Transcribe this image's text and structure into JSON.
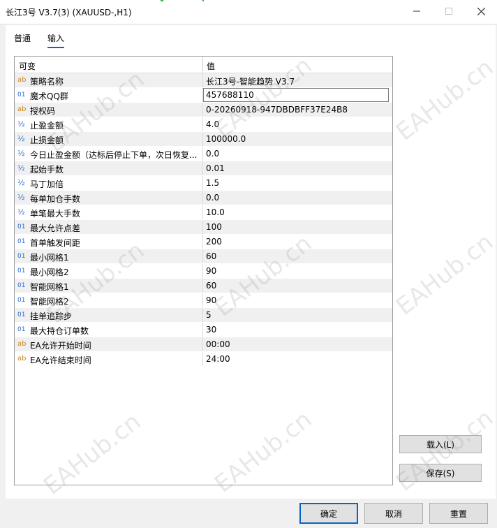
{
  "window": {
    "title": "长江3号 V3.7(3) (XAUUSD-,H1)"
  },
  "tabs": [
    {
      "label": "普通"
    },
    {
      "label": "输入"
    }
  ],
  "grid": {
    "col_variable": "可变",
    "col_value": "值",
    "rows": [
      {
        "type": "ab",
        "name": "策略名称",
        "value": "长江3号-智能趋势 V3.7"
      },
      {
        "type": "01",
        "name": "魔术QQ群",
        "value": "457688110"
      },
      {
        "type": "ab",
        "name": "授权码",
        "value": "0-20260918-947DBDBFF37E24B8"
      },
      {
        "type": "½",
        "name": "止盈金额",
        "value": "4.0"
      },
      {
        "type": "½",
        "name": "止损金额",
        "value": "100000.0"
      },
      {
        "type": "½",
        "name": "今日止盈金额（达标后停止下单，次日恢复...",
        "value": "0.0"
      },
      {
        "type": "½",
        "name": "起始手数",
        "value": "0.01"
      },
      {
        "type": "½",
        "name": "马丁加倍",
        "value": "1.5"
      },
      {
        "type": "½",
        "name": "每单加仓手数",
        "value": "0.0"
      },
      {
        "type": "½",
        "name": "单笔最大手数",
        "value": "10.0"
      },
      {
        "type": "01",
        "name": "最大允许点差",
        "value": "100"
      },
      {
        "type": "01",
        "name": "首单触发间距",
        "value": "200"
      },
      {
        "type": "01",
        "name": "最小网格1",
        "value": "60"
      },
      {
        "type": "01",
        "name": "最小网格2",
        "value": "90"
      },
      {
        "type": "01",
        "name": "智能网格1",
        "value": "60"
      },
      {
        "type": "01",
        "name": "智能网格2",
        "value": "90"
      },
      {
        "type": "01",
        "name": "挂单追踪步",
        "value": "5"
      },
      {
        "type": "01",
        "name": "最大持仓订单数",
        "value": "30"
      },
      {
        "type": "ab",
        "name": "EA允许开始时间",
        "value": "00:00"
      },
      {
        "type": "ab",
        "name": "EA允许结束时间",
        "value": "24:00"
      }
    ]
  },
  "buttons": {
    "load": "载入(L)",
    "save": "保存(S)",
    "ok": "确定",
    "cancel": "取消",
    "reset": "重置"
  },
  "watermark": "EAHub.cn",
  "colors": {
    "accent": "#0a64c8",
    "string_icon": "#c98a1b",
    "number_icon": "#2b6cd4"
  }
}
